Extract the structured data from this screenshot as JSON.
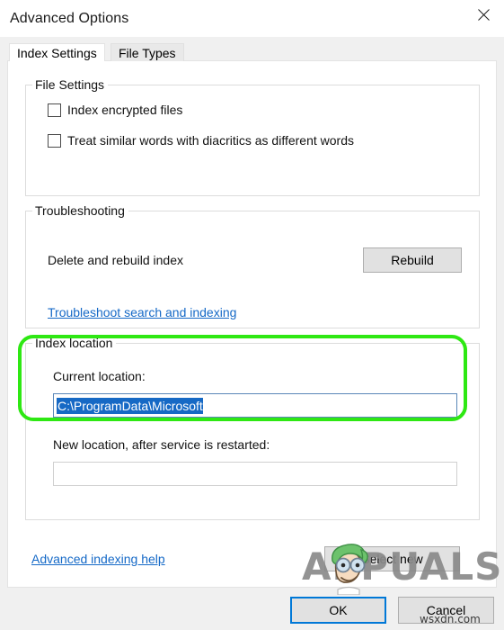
{
  "window": {
    "title": "Advanced Options",
    "close_icon": "close-icon"
  },
  "tabs": [
    {
      "label": "Index Settings",
      "active": true
    },
    {
      "label": "File Types",
      "active": false
    }
  ],
  "groups": {
    "file_settings": {
      "legend": "File Settings",
      "checkboxes": [
        {
          "label": "Index encrypted files",
          "checked": false
        },
        {
          "label": "Treat similar words with diacritics as different words",
          "checked": false
        }
      ]
    },
    "troubleshooting": {
      "legend": "Troubleshooting",
      "row_label": "Delete and rebuild index",
      "rebuild_button": "Rebuild",
      "link": "Troubleshoot search and indexing"
    },
    "index_location": {
      "legend": "Index location",
      "current_label": "Current location:",
      "current_value": "C:\\ProgramData\\Microsoft",
      "current_value_selected": true,
      "new_label": "New location, after service is restarted:",
      "new_value": "",
      "select_new_button": "Select new"
    }
  },
  "footer": {
    "help_link": "Advanced indexing help",
    "ok_button": "OK",
    "cancel_button": "Cancel"
  },
  "annotation": {
    "highlight_color": "#2ee813",
    "target": "index-location-group"
  },
  "watermarks": {
    "brand": "APPUALS",
    "site": "wsxdn.com"
  },
  "colors": {
    "link": "#1569c7",
    "selection": "#1669c5",
    "focus_border": "#0078d7",
    "button_face": "#e1e1e1",
    "dialog_background": "#f0f0f0"
  }
}
